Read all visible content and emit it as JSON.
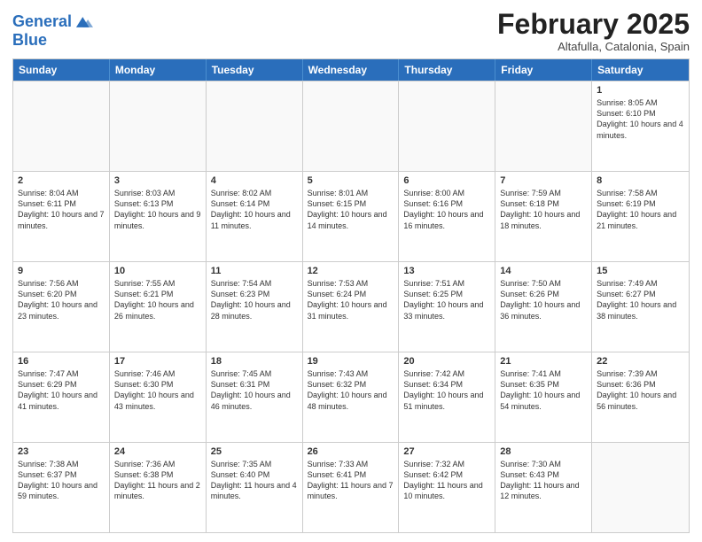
{
  "header": {
    "logo_line1": "General",
    "logo_line2": "Blue",
    "month": "February 2025",
    "location": "Altafulla, Catalonia, Spain"
  },
  "weekdays": [
    "Sunday",
    "Monday",
    "Tuesday",
    "Wednesday",
    "Thursday",
    "Friday",
    "Saturday"
  ],
  "weeks": [
    [
      {
        "day": "",
        "info": ""
      },
      {
        "day": "",
        "info": ""
      },
      {
        "day": "",
        "info": ""
      },
      {
        "day": "",
        "info": ""
      },
      {
        "day": "",
        "info": ""
      },
      {
        "day": "",
        "info": ""
      },
      {
        "day": "1",
        "info": "Sunrise: 8:05 AM\nSunset: 6:10 PM\nDaylight: 10 hours and 4 minutes."
      }
    ],
    [
      {
        "day": "2",
        "info": "Sunrise: 8:04 AM\nSunset: 6:11 PM\nDaylight: 10 hours and 7 minutes."
      },
      {
        "day": "3",
        "info": "Sunrise: 8:03 AM\nSunset: 6:13 PM\nDaylight: 10 hours and 9 minutes."
      },
      {
        "day": "4",
        "info": "Sunrise: 8:02 AM\nSunset: 6:14 PM\nDaylight: 10 hours and 11 minutes."
      },
      {
        "day": "5",
        "info": "Sunrise: 8:01 AM\nSunset: 6:15 PM\nDaylight: 10 hours and 14 minutes."
      },
      {
        "day": "6",
        "info": "Sunrise: 8:00 AM\nSunset: 6:16 PM\nDaylight: 10 hours and 16 minutes."
      },
      {
        "day": "7",
        "info": "Sunrise: 7:59 AM\nSunset: 6:18 PM\nDaylight: 10 hours and 18 minutes."
      },
      {
        "day": "8",
        "info": "Sunrise: 7:58 AM\nSunset: 6:19 PM\nDaylight: 10 hours and 21 minutes."
      }
    ],
    [
      {
        "day": "9",
        "info": "Sunrise: 7:56 AM\nSunset: 6:20 PM\nDaylight: 10 hours and 23 minutes."
      },
      {
        "day": "10",
        "info": "Sunrise: 7:55 AM\nSunset: 6:21 PM\nDaylight: 10 hours and 26 minutes."
      },
      {
        "day": "11",
        "info": "Sunrise: 7:54 AM\nSunset: 6:23 PM\nDaylight: 10 hours and 28 minutes."
      },
      {
        "day": "12",
        "info": "Sunrise: 7:53 AM\nSunset: 6:24 PM\nDaylight: 10 hours and 31 minutes."
      },
      {
        "day": "13",
        "info": "Sunrise: 7:51 AM\nSunset: 6:25 PM\nDaylight: 10 hours and 33 minutes."
      },
      {
        "day": "14",
        "info": "Sunrise: 7:50 AM\nSunset: 6:26 PM\nDaylight: 10 hours and 36 minutes."
      },
      {
        "day": "15",
        "info": "Sunrise: 7:49 AM\nSunset: 6:27 PM\nDaylight: 10 hours and 38 minutes."
      }
    ],
    [
      {
        "day": "16",
        "info": "Sunrise: 7:47 AM\nSunset: 6:29 PM\nDaylight: 10 hours and 41 minutes."
      },
      {
        "day": "17",
        "info": "Sunrise: 7:46 AM\nSunset: 6:30 PM\nDaylight: 10 hours and 43 minutes."
      },
      {
        "day": "18",
        "info": "Sunrise: 7:45 AM\nSunset: 6:31 PM\nDaylight: 10 hours and 46 minutes."
      },
      {
        "day": "19",
        "info": "Sunrise: 7:43 AM\nSunset: 6:32 PM\nDaylight: 10 hours and 48 minutes."
      },
      {
        "day": "20",
        "info": "Sunrise: 7:42 AM\nSunset: 6:34 PM\nDaylight: 10 hours and 51 minutes."
      },
      {
        "day": "21",
        "info": "Sunrise: 7:41 AM\nSunset: 6:35 PM\nDaylight: 10 hours and 54 minutes."
      },
      {
        "day": "22",
        "info": "Sunrise: 7:39 AM\nSunset: 6:36 PM\nDaylight: 10 hours and 56 minutes."
      }
    ],
    [
      {
        "day": "23",
        "info": "Sunrise: 7:38 AM\nSunset: 6:37 PM\nDaylight: 10 hours and 59 minutes."
      },
      {
        "day": "24",
        "info": "Sunrise: 7:36 AM\nSunset: 6:38 PM\nDaylight: 11 hours and 2 minutes."
      },
      {
        "day": "25",
        "info": "Sunrise: 7:35 AM\nSunset: 6:40 PM\nDaylight: 11 hours and 4 minutes."
      },
      {
        "day": "26",
        "info": "Sunrise: 7:33 AM\nSunset: 6:41 PM\nDaylight: 11 hours and 7 minutes."
      },
      {
        "day": "27",
        "info": "Sunrise: 7:32 AM\nSunset: 6:42 PM\nDaylight: 11 hours and 10 minutes."
      },
      {
        "day": "28",
        "info": "Sunrise: 7:30 AM\nSunset: 6:43 PM\nDaylight: 11 hours and 12 minutes."
      },
      {
        "day": "",
        "info": ""
      }
    ]
  ]
}
